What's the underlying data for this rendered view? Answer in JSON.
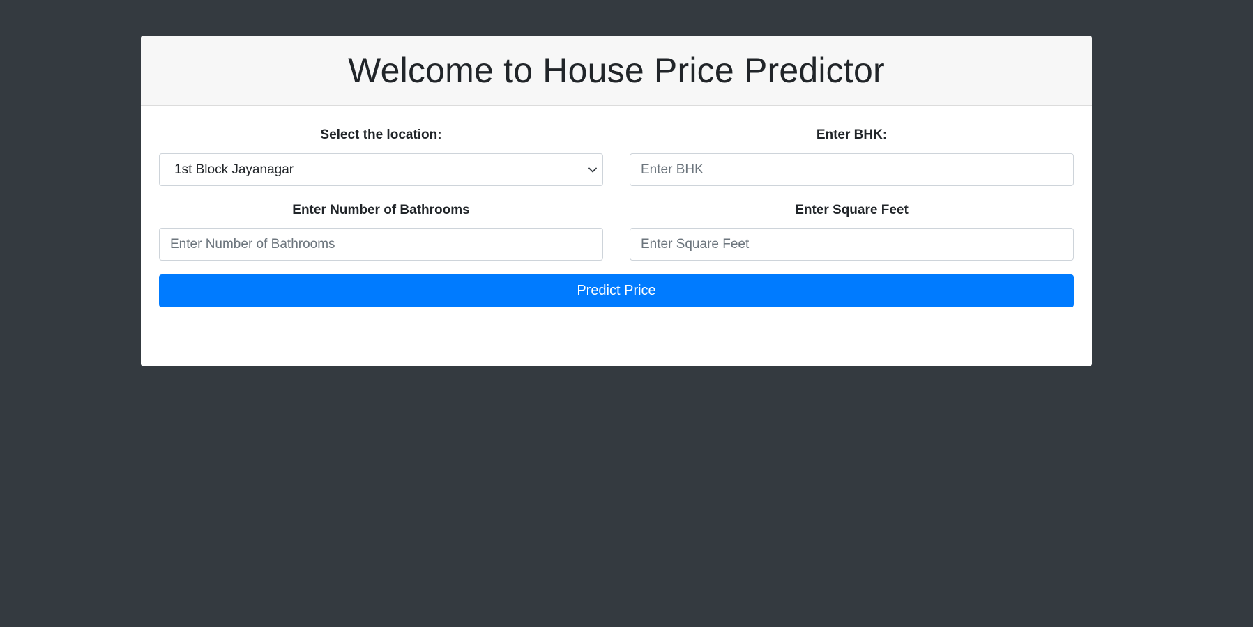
{
  "header": {
    "title": "Welcome to House Price Predictor"
  },
  "form": {
    "location": {
      "label": "Select the location:",
      "selected": "1st Block Jayanagar"
    },
    "bhk": {
      "label": "Enter BHK:",
      "placeholder": "Enter BHK",
      "value": ""
    },
    "bathrooms": {
      "label": "Enter Number of Bathrooms",
      "placeholder": "Enter Number of Bathrooms",
      "value": ""
    },
    "sqft": {
      "label": "Enter Square Feet",
      "placeholder": "Enter Square Feet",
      "value": ""
    },
    "submit_label": "Predict Price"
  },
  "icons": {
    "select_arrow": "chevron-down-icon"
  },
  "colors": {
    "page_background": "#343a40",
    "card_background": "#ffffff",
    "header_background": "#f7f7f7",
    "primary_button": "#007bff"
  }
}
